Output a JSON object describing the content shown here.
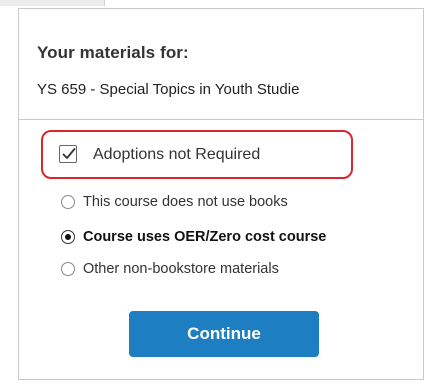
{
  "header": {
    "heading": "Your materials for:",
    "course": "YS 659 - Special Topics in Youth Studie"
  },
  "adoptions": {
    "label": "Adoptions not Required",
    "checked": true
  },
  "options": [
    {
      "label": "This course does not use books",
      "selected": false
    },
    {
      "label": "Course uses OER/Zero cost course",
      "selected": true
    },
    {
      "label": "Other non-bookstore materials",
      "selected": false
    }
  ],
  "actions": {
    "continue_label": "Continue"
  },
  "colors": {
    "accent": "#1d7ec2",
    "highlight_border": "#d9262f"
  }
}
